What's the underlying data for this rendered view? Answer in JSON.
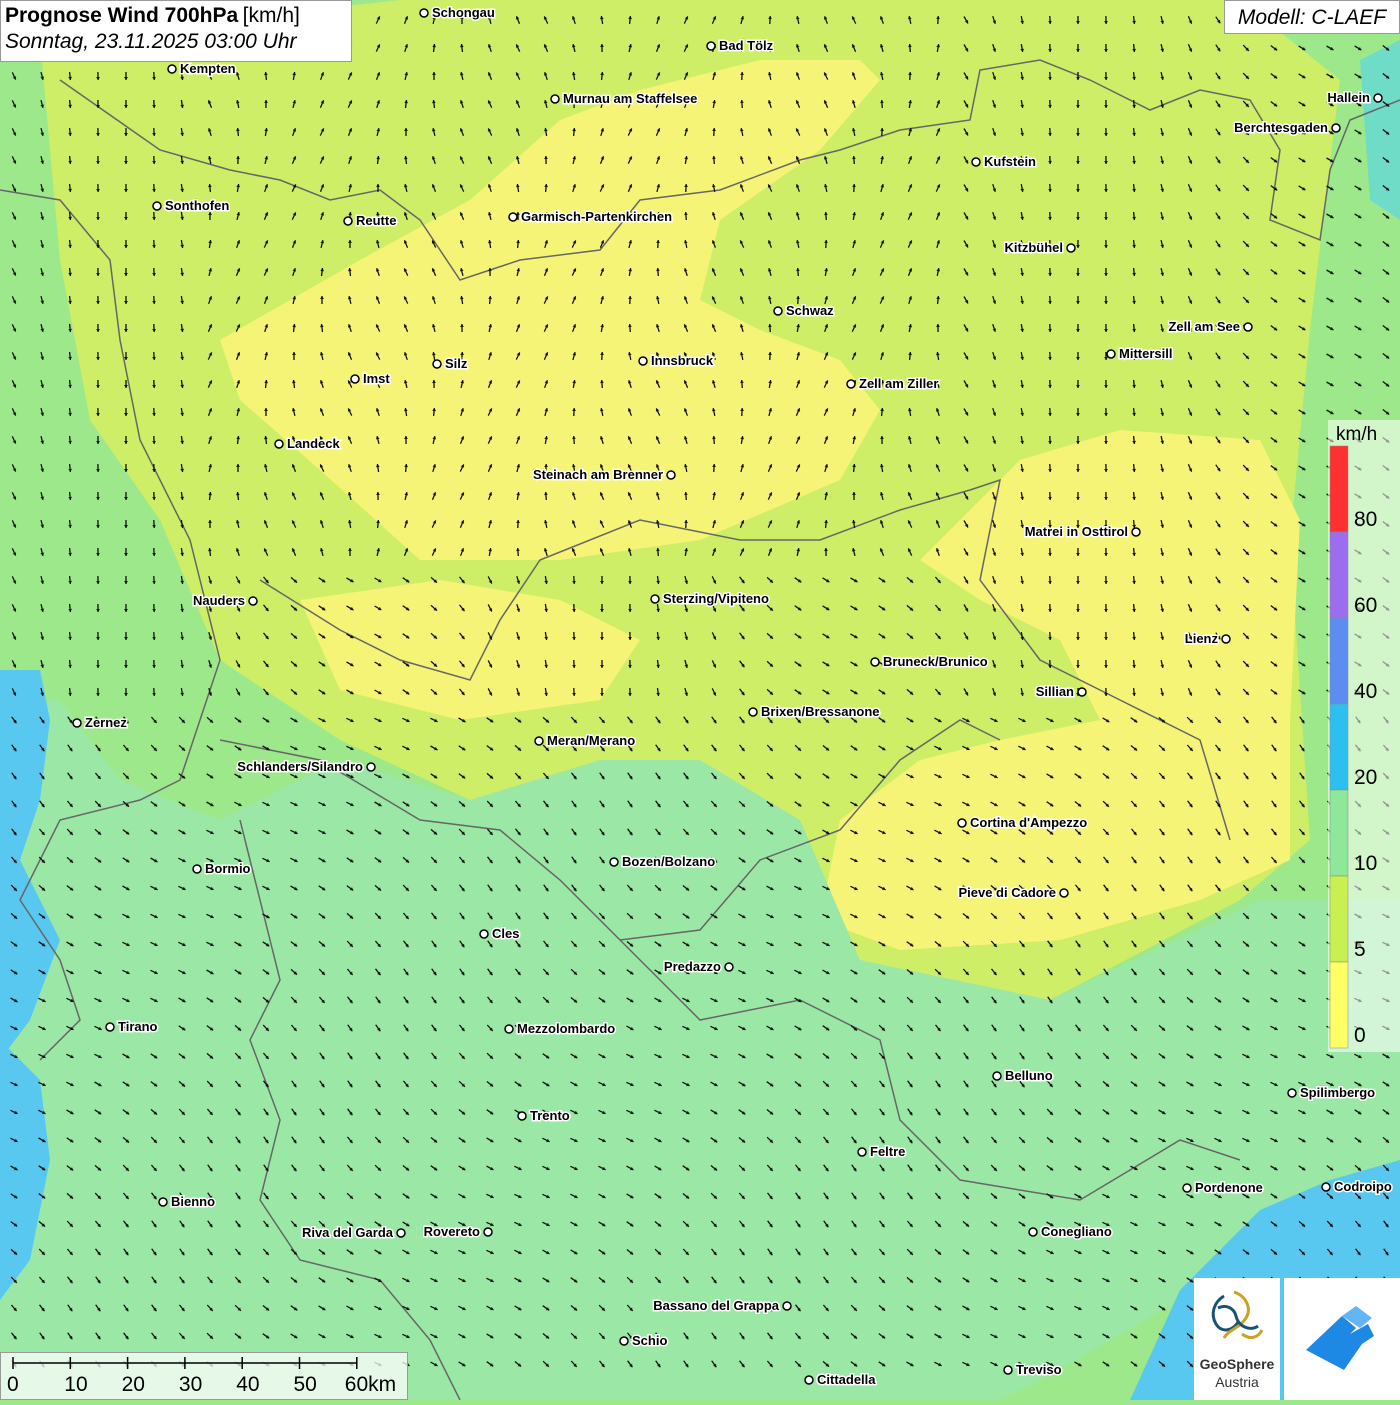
{
  "title": {
    "main": "Prognose Wind 700hPa",
    "unit": "[km/h]",
    "date": "Sonntag, 23.11.2025 03:00 Uhr"
  },
  "model": "Modell: C-LAEF",
  "legend": {
    "unit": "km/h",
    "labels": [
      "80",
      "60",
      "40",
      "20",
      "10",
      "5",
      "0"
    ],
    "colors": [
      "#ff3030",
      "#9d6df0",
      "#5b8ef0",
      "#2cc0f0",
      "#8ee89a",
      "#c8f050",
      "#ffff66"
    ]
  },
  "scale": {
    "labels": [
      "0",
      "10",
      "20",
      "30",
      "40",
      "50",
      "60km"
    ]
  },
  "logos": {
    "geosphere_line1": "GeoSphere",
    "geosphere_line2": "Austria"
  },
  "cities": [
    {
      "name": "Schongau"
    },
    {
      "name": "Bad Tölz"
    },
    {
      "name": "Kempten"
    },
    {
      "name": "Murnau am Staffelsee"
    },
    {
      "name": "Hallein"
    },
    {
      "name": "Berchtesgaden"
    },
    {
      "name": "Kufstein"
    },
    {
      "name": "Sonthofen"
    },
    {
      "name": "Reutte"
    },
    {
      "name": "Garmisch-Partenkirchen"
    },
    {
      "name": "Kitzbühel"
    },
    {
      "name": "Schwaz"
    },
    {
      "name": "Zell am See"
    },
    {
      "name": "Mittersill"
    },
    {
      "name": "Innsbruck"
    },
    {
      "name": "Silz"
    },
    {
      "name": "Imst"
    },
    {
      "name": "Zell am Ziller"
    },
    {
      "name": "Landeck"
    },
    {
      "name": "Steinach am Brenner"
    },
    {
      "name": "Matrei in Osttirol"
    },
    {
      "name": "Nauders"
    },
    {
      "name": "Sterzing/Vipiteno"
    },
    {
      "name": "Lienz"
    },
    {
      "name": "Bruneck/Brunico"
    },
    {
      "name": "Sillian"
    },
    {
      "name": "Zernez"
    },
    {
      "name": "Brixen/Bressanone"
    },
    {
      "name": "Meran/Merano"
    },
    {
      "name": "Schlanders/Silandro"
    },
    {
      "name": "Cortina d'Ampezzo"
    },
    {
      "name": "Bormio"
    },
    {
      "name": "Bozen/Bolzano"
    },
    {
      "name": "Pieve di Cadore"
    },
    {
      "name": "Cles"
    },
    {
      "name": "Predazzo"
    },
    {
      "name": "Tirano"
    },
    {
      "name": "Mezzolombardo"
    },
    {
      "name": "Belluno"
    },
    {
      "name": "Spilimbergo"
    },
    {
      "name": "Trento"
    },
    {
      "name": "Feltre"
    },
    {
      "name": "Pordenone"
    },
    {
      "name": "Codroipo"
    },
    {
      "name": "Bienno"
    },
    {
      "name": "Riva del Garda"
    },
    {
      "name": "Rovereto"
    },
    {
      "name": "Conegliano"
    },
    {
      "name": "Bassano del Grappa"
    },
    {
      "name": "Schio"
    },
    {
      "name": "Treviso"
    },
    {
      "name": "Cittadella"
    }
  ]
}
